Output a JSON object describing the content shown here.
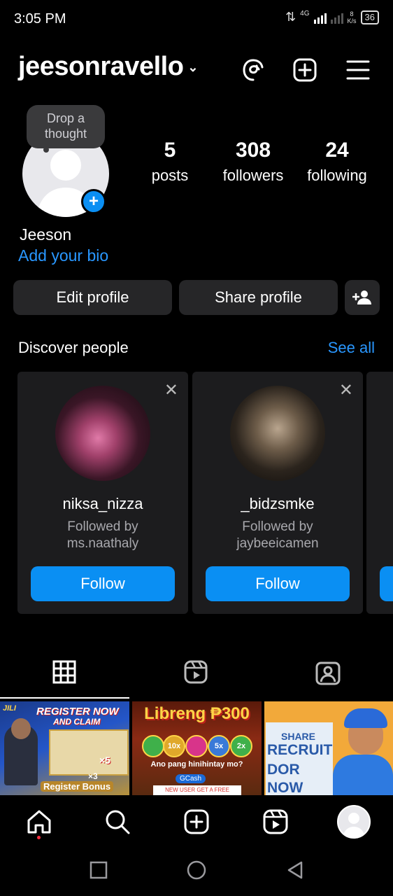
{
  "status_bar": {
    "time": "3:05 PM",
    "network": "4G",
    "speed_value": "8",
    "speed_unit": "K/s",
    "battery": "36"
  },
  "header": {
    "username": "jeesonravello",
    "icons": [
      "threads-icon",
      "create-post-icon",
      "menu-icon"
    ]
  },
  "profile": {
    "note_bubble": "Drop a thought",
    "stats": [
      {
        "value": "5",
        "label": "posts"
      },
      {
        "value": "308",
        "label": "followers"
      },
      {
        "value": "24",
        "label": "following"
      }
    ],
    "display_name": "Jeeson",
    "bio_link": "Add your bio"
  },
  "actions": {
    "edit_profile": "Edit profile",
    "share_profile": "Share profile"
  },
  "discover": {
    "title": "Discover people",
    "see_all": "See all",
    "cards": [
      {
        "username": "niksa_nizza",
        "followed_by_label": "Followed by",
        "followed_by": "ms.naathaly",
        "follow_label": "Follow"
      },
      {
        "username": "_bidzsmke",
        "followed_by_label": "Followed by",
        "followed_by": "jaybeeicamen",
        "follow_label": "Follow"
      }
    ]
  },
  "posts": [
    {
      "lines": [
        "JILI",
        "REGISTER NOW",
        "AND CLAIM",
        "×5",
        "×3",
        "Register Bonus"
      ]
    },
    {
      "lines": [
        "Libreng ₱300",
        "10x",
        "5x",
        "2x",
        "Ano pang hinihintay mo?",
        "GCash",
        "NEW USER GET A FREE"
      ]
    },
    {
      "lines": [
        "SHARE",
        "RECRUIT",
        "DOR",
        "NOW"
      ]
    }
  ],
  "colors": {
    "accent": "#0a8ff3",
    "link": "#2997ff",
    "card_bg": "#1c1c1e",
    "button_bg": "#262628"
  }
}
